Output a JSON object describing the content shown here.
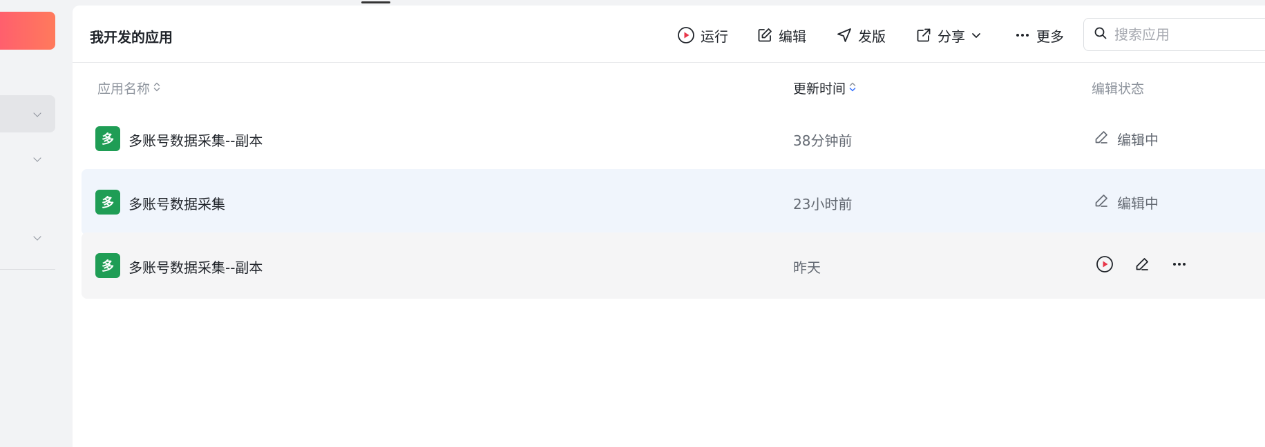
{
  "header": {
    "title": "我开发的应用",
    "toolbar": {
      "run_label": "运行",
      "edit_label": "编辑",
      "publish_label": "发版",
      "share_label": "分享",
      "more_label": "更多"
    },
    "search": {
      "placeholder": "搜索应用",
      "value": ""
    }
  },
  "table": {
    "columns": {
      "name": "应用名称",
      "updated": "更新时间",
      "status": "编辑状态"
    },
    "rows": [
      {
        "icon_text": "多",
        "name": "多账号数据采集--副本",
        "updated": "38分钟前",
        "status": "编辑中"
      },
      {
        "icon_text": "多",
        "name": "多账号数据采集",
        "updated": "23小时前",
        "status": "编辑中"
      },
      {
        "icon_text": "多",
        "name": "多账号数据采集--副本",
        "updated": "昨天",
        "status": ""
      }
    ]
  },
  "colors": {
    "app_icon": "#1f9d55",
    "accent_gradient_start": "#ff5f6d",
    "accent_gradient_end": "#ff7a5c",
    "hover_row": "#f0f5fc",
    "selected_row": "#f5f5f6",
    "run_red": "#e8364a",
    "sort_active_blue": "#3370ff"
  },
  "icons": {
    "run": "play-circle-icon",
    "edit": "pencil-square-icon",
    "publish": "send-arrow-icon",
    "share": "external-link-icon",
    "more": "ellipsis-icon",
    "search": "search-icon",
    "status_edit": "pencil-icon"
  }
}
